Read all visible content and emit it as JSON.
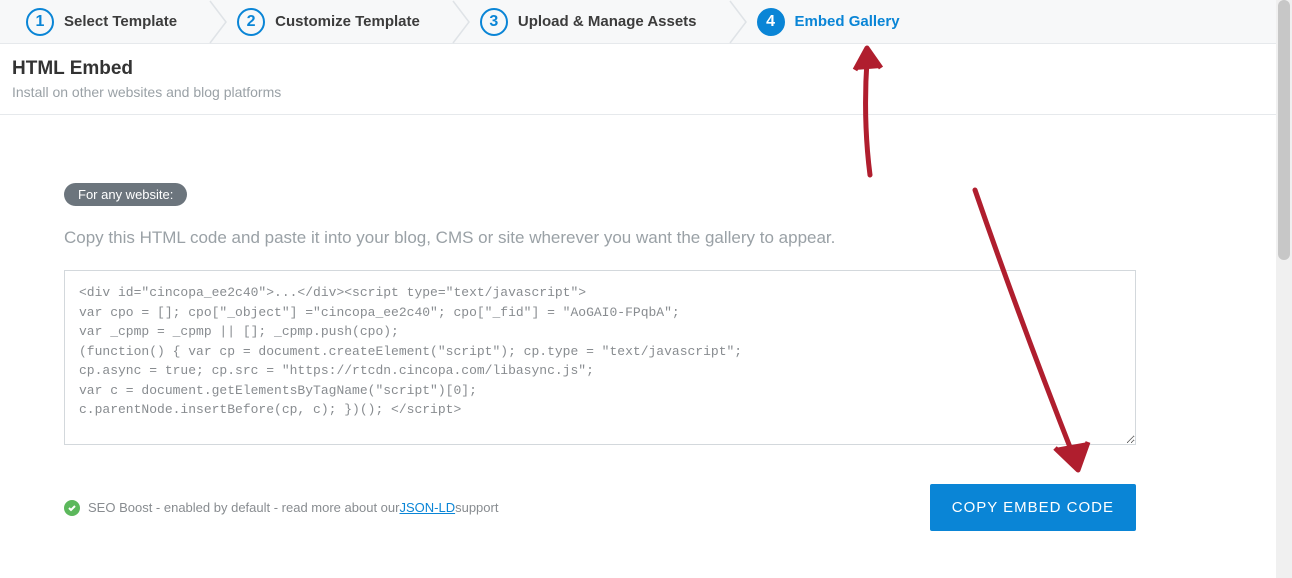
{
  "stepper": {
    "steps": [
      {
        "num": "1",
        "label": "Select Template",
        "active": false
      },
      {
        "num": "2",
        "label": "Customize Template",
        "active": false
      },
      {
        "num": "3",
        "label": "Upload & Manage Assets",
        "active": false
      },
      {
        "num": "4",
        "label": "Embed Gallery",
        "active": true
      }
    ]
  },
  "header": {
    "title": "HTML Embed",
    "subtitle": "Install on other websites and blog platforms"
  },
  "badge_label": "For any website:",
  "instruction": "Copy this HTML code and paste it into your blog, CMS or site wherever you want the gallery to appear.",
  "embed_code": "<div id=\"cincopa_ee2c40\">...</div><script type=\"text/javascript\">\nvar cpo = []; cpo[\"_object\"] =\"cincopa_ee2c40\"; cpo[\"_fid\"] = \"AoGAI0-FPqbA\";\nvar _cpmp = _cpmp || []; _cpmp.push(cpo);\n(function() { var cp = document.createElement(\"script\"); cp.type = \"text/javascript\";\ncp.async = true; cp.src = \"https://rtcdn.cincopa.com/libasync.js\";\nvar c = document.getElementsByTagName(\"script\")[0];\nc.parentNode.insertBefore(cp, c); })(); </script>",
  "seo": {
    "prefix": "SEO Boost - enabled by default - read more about our ",
    "link_text": "JSON-LD",
    "suffix": " support"
  },
  "copy_button_label": "COPY EMBED CODE"
}
